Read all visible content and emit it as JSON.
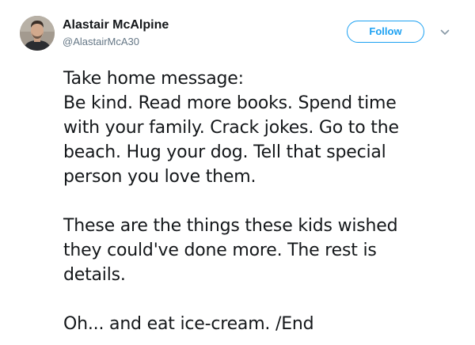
{
  "author": {
    "display_name": "Alastair McAlpine",
    "handle": "@AlastairMcA30"
  },
  "actions": {
    "follow_label": "Follow",
    "caret_icon": "chevron-down-icon"
  },
  "tweet": {
    "paragraphs": [
      {
        "lines": [
          "Take home message:",
          "Be kind. Read more books. Spend time",
          "with your family. Crack jokes. Go to the",
          "beach. Hug your dog. Tell that special",
          "person you love them."
        ]
      },
      {
        "lines": [
          "These are the things these kids wished",
          "they could've done more. The rest is",
          "details."
        ]
      },
      {
        "lines": [
          "Oh... and eat ice-cream. /End"
        ]
      }
    ]
  },
  "colors": {
    "accent": "#1da1f2",
    "text": "#14171a",
    "secondary_text": "#657786",
    "caret": "#8899a6"
  }
}
